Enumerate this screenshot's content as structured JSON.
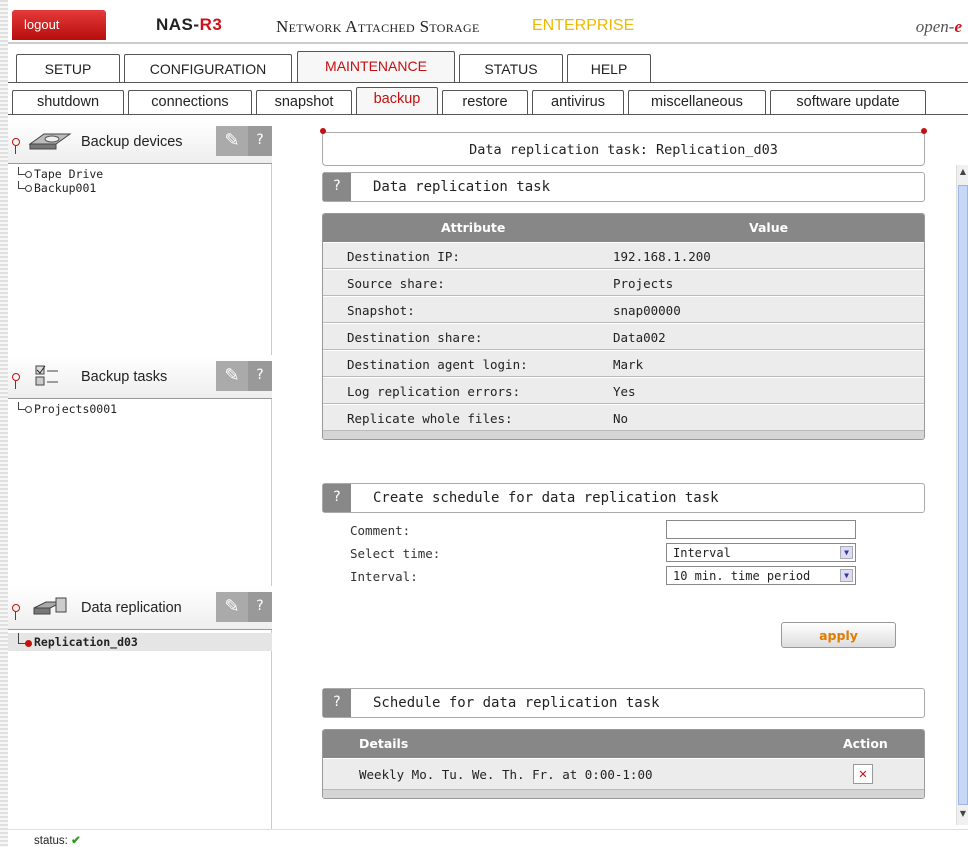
{
  "header": {
    "logout": "logout",
    "product_prefix": "NAS-",
    "product_suffix": "R3",
    "product_title": "Network Attached Storage",
    "edition": "ENTERPRISE",
    "logo_prefix": "open-",
    "logo_suffix": "e"
  },
  "tabs": [
    "SETUP",
    "CONFIGURATION",
    "MAINTENANCE",
    "STATUS",
    "HELP"
  ],
  "active_tab": "MAINTENANCE",
  "subtabs": [
    "shutdown",
    "connections",
    "snapshot",
    "backup",
    "restore",
    "antivirus",
    "miscellaneous",
    "software update"
  ],
  "active_subtab": "backup",
  "sidebar": {
    "devices": {
      "title": "Backup devices",
      "tool_icon": "wrench-icon",
      "help": "?",
      "items": [
        "Tape Drive",
        "Backup001"
      ]
    },
    "tasks": {
      "title": "Backup tasks",
      "tool_icon": "wrench-icon",
      "help": "?",
      "items": [
        "Projects0001"
      ]
    },
    "replication": {
      "title": "Data replication",
      "tool_icon": "wrench-icon",
      "help": "?",
      "items": [
        "Replication_d03"
      ]
    }
  },
  "main": {
    "page_title": "Data replication task: Replication_d03",
    "task_box": {
      "help": "?",
      "title": "Data replication task"
    },
    "task_table": {
      "col_attr": "Attribute",
      "col_val": "Value",
      "rows": [
        {
          "attr": "Destination IP:",
          "val": "192.168.1.200"
        },
        {
          "attr": "Source share:",
          "val": "Projects"
        },
        {
          "attr": "Snapshot:",
          "val": "snap00000"
        },
        {
          "attr": "Destination share:",
          "val": "Data002"
        },
        {
          "attr": "Destination agent login:",
          "val": "Mark"
        },
        {
          "attr": "Log replication errors:",
          "val": "Yes"
        },
        {
          "attr": "Replicate whole files:",
          "val": "No"
        }
      ]
    },
    "schedule_box": {
      "help": "?",
      "title": "Create schedule for data replication task"
    },
    "form": {
      "comment_label": "Comment:",
      "comment_value": "",
      "time_label": "Select time:",
      "time_value": "Interval",
      "interval_label": "Interval:",
      "interval_value": "10 min. time period"
    },
    "apply": "apply",
    "list_box": {
      "help": "?",
      "title": "Schedule for data replication task"
    },
    "list_table": {
      "col_details": "Details",
      "col_action": "Action",
      "rows": [
        {
          "details": "Weekly Mo. Tu. We. Th. Fr. at 0:00-1:00",
          "action_icon": "delete-icon"
        }
      ]
    }
  },
  "status": {
    "label": "status:",
    "ok_icon": "check-icon"
  }
}
